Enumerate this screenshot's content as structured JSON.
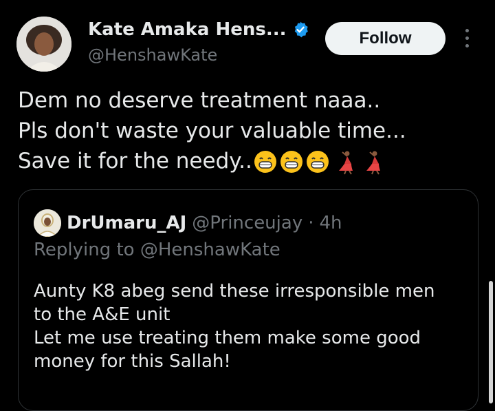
{
  "author": {
    "display_name": "Kate Amaka Hens...",
    "handle": "@HenshawKate",
    "verified": true,
    "verified_badge_color": "#1d9bf0"
  },
  "actions": {
    "follow_label": "Follow",
    "more_icon": "more-vertical-icon"
  },
  "tweet": {
    "lines": [
      "Dem no deserve treatment naaa..",
      "Pls don't waste your valuable time...",
      "Save it for the needy.."
    ],
    "emojis": [
      "grinning-face",
      "grinning-face",
      "grinning-face",
      "woman-dancing",
      "woman-dancing"
    ]
  },
  "quoted_tweet": {
    "display_name": "DrUmaru_AJ",
    "handle": "@Princeujay",
    "separator": "·",
    "time": "4h",
    "replying_to": "Replying to @HenshawKate",
    "lines": [
      "Aunty K8 abeg send these irresponsible men",
      "to the A&E unit",
      "Let me use treating them make some good",
      "money for this Sallah!"
    ]
  },
  "colors": {
    "background": "#000000",
    "text": "#e7e9ea",
    "muted": "#71767b",
    "border": "#2f3336",
    "follow_bg": "#eff3f4"
  }
}
